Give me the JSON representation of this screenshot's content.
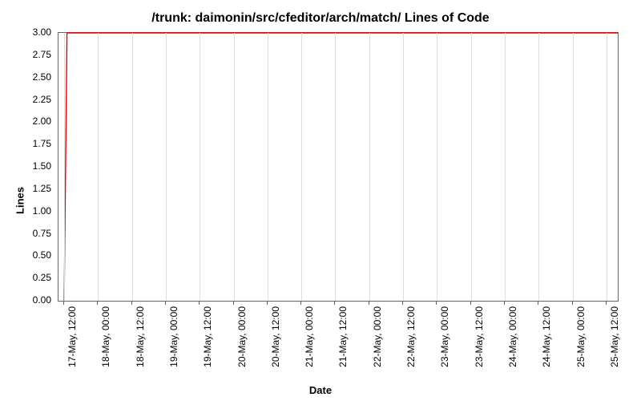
{
  "chart_data": {
    "type": "line",
    "title": "/trunk: daimonin/src/cfeditor/arch/match/ Lines of Code",
    "xlabel": "Date",
    "ylabel": "Lines",
    "ylim": [
      0.0,
      3.0
    ],
    "y_ticks": [
      0.0,
      0.25,
      0.5,
      0.75,
      1.0,
      1.25,
      1.5,
      1.75,
      2.0,
      2.25,
      2.5,
      2.75,
      3.0
    ],
    "x_ticks": [
      "17-May, 12:00",
      "18-May, 00:00",
      "18-May, 12:00",
      "19-May, 00:00",
      "19-May, 12:00",
      "20-May, 00:00",
      "20-May, 12:00",
      "21-May, 00:00",
      "21-May, 12:00",
      "22-May, 00:00",
      "22-May, 12:00",
      "23-May, 00:00",
      "23-May, 12:00",
      "24-May, 00:00",
      "24-May, 12:00",
      "25-May, 00:00",
      "25-May, 12:00"
    ],
    "series": [
      {
        "name": "Lines",
        "color": "#ee0000",
        "points": [
          {
            "x": "17-May, 12:00",
            "y": 0
          },
          {
            "x": "17-May, 13:00",
            "y": 3
          },
          {
            "x": "25-May, 16:00",
            "y": 3
          }
        ]
      }
    ]
  }
}
